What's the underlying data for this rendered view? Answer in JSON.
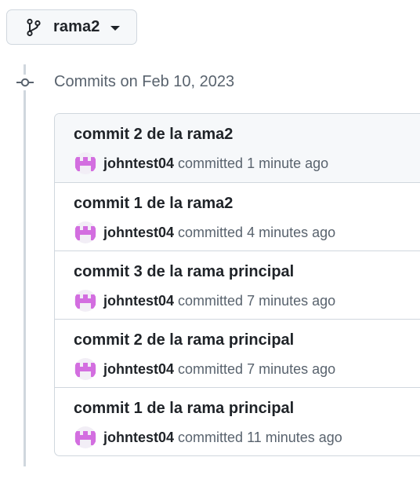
{
  "branch_selector": {
    "label": "rama2",
    "icon": "git-branch-icon"
  },
  "timeline": {
    "date_header": "Commits on Feb 10, 2023",
    "icon": "git-commit-icon"
  },
  "commits": [
    {
      "title": "commit 2 de la rama2",
      "author": "johntest04",
      "verb": "committed",
      "time": "1 minute ago"
    },
    {
      "title": "commit 1 de la rama2",
      "author": "johntest04",
      "verb": "committed",
      "time": "4 minutes ago"
    },
    {
      "title": "commit 3 de la rama principal",
      "author": "johntest04",
      "verb": "committed",
      "time": "7 minutes ago"
    },
    {
      "title": "commit 2 de la rama principal",
      "author": "johntest04",
      "verb": "committed",
      "time": "7 minutes ago"
    },
    {
      "title": "commit 1 de la rama principal",
      "author": "johntest04",
      "verb": "committed",
      "time": "11 minutes ago"
    }
  ],
  "colors": {
    "avatar_pink": "#d36ee0",
    "border": "#d0d7de",
    "muted_text": "#59636e"
  }
}
